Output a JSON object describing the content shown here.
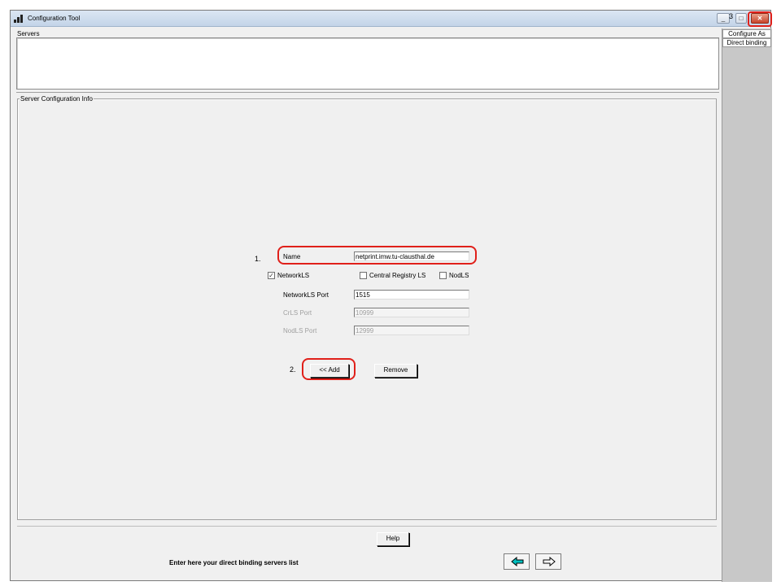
{
  "window": {
    "title": "Configuration Tool",
    "minimize_glyph": "_",
    "maximize_glyph": "□",
    "close_glyph": "✕",
    "annotation_number": "3"
  },
  "servers": {
    "label": "Servers",
    "items": []
  },
  "config": {
    "group_label": "Server Configuration Info",
    "name_label": "Name",
    "name_value": "netprint.imw.tu-clausthal.de",
    "checkboxes": [
      {
        "label": "NetworkLS",
        "checked": true
      },
      {
        "label": "Central Registry LS",
        "checked": false
      },
      {
        "label": "NodLS",
        "checked": false
      }
    ],
    "networkls_port_label": "NetworkLS Port",
    "networkls_port_value": "1515",
    "crls_port_label": "CrLS Port",
    "crls_port_value": "10999",
    "nodls_port_label": "NodLS Port",
    "nodls_port_value": "12999",
    "add_button": "<< Add",
    "remove_button": "Remove"
  },
  "annotations": {
    "step1": "1.",
    "step2": "2."
  },
  "right_panel": {
    "tabs": [
      "Configure As",
      "Direct binding"
    ]
  },
  "footer": {
    "help_button": "Help",
    "hint": "Enter here your direct binding servers list",
    "back_icon": "left-arrow-icon",
    "next_icon": "right-arrow-icon"
  },
  "colors": {
    "annotation": "#e0201a",
    "nav_arrow": "#00c0c0",
    "window_bg": "#f0f0f0",
    "right_panel_bg": "#c8c8c8"
  }
}
